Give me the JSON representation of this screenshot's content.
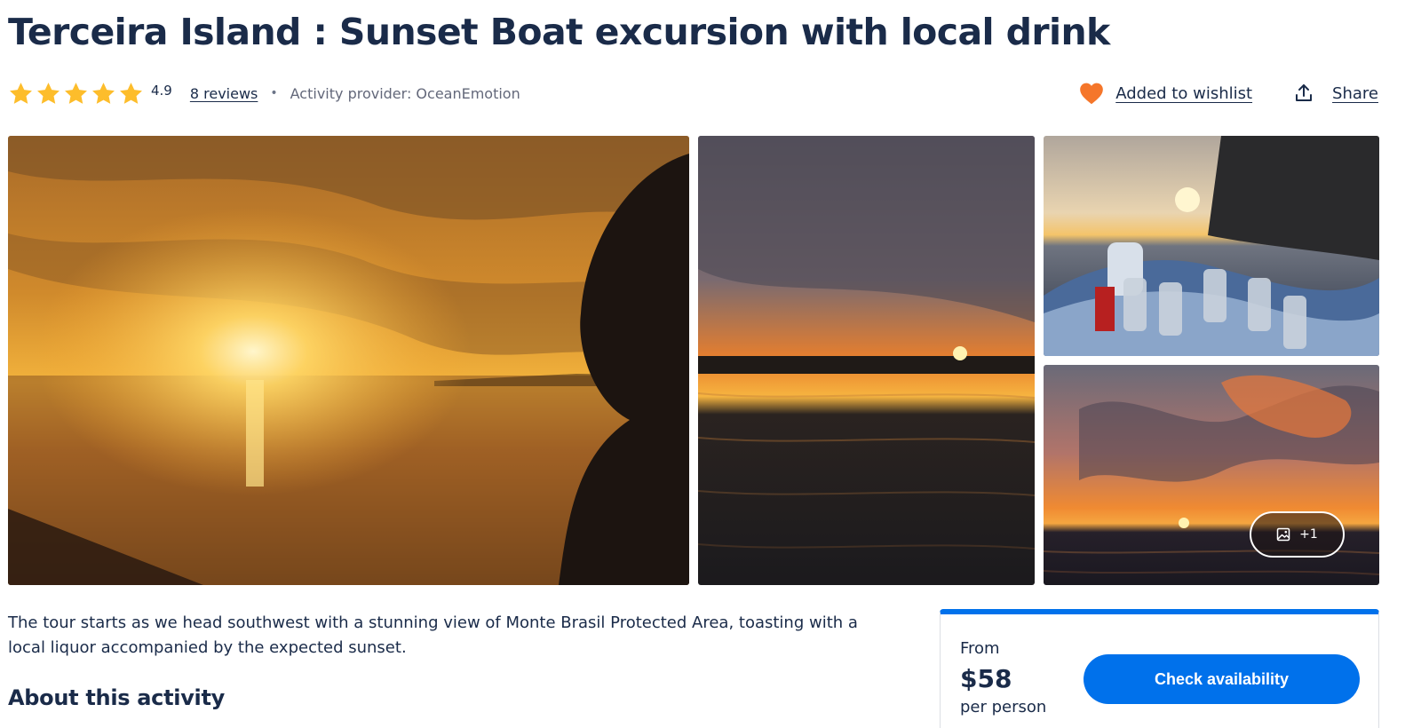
{
  "activity": {
    "title": "Terceira Island : Sunset Boat excursion with local drink",
    "rating": 4.9,
    "rating_text": "4.9",
    "stars": 5,
    "reviews_label": "8 reviews",
    "separator": "•",
    "provider_label": "Activity provider: OceanEmotion"
  },
  "actions": {
    "wishlist_label": "Added to wishlist",
    "share_label": "Share",
    "wishlist_icon": "heart-icon",
    "share_icon": "share-icon"
  },
  "gallery": {
    "more_photos_label": "+1",
    "more_photos_icon": "image-icon"
  },
  "content": {
    "description": "The tour starts as we head southwest with a stunning view of Monte Brasil Protected Area, toasting with a local liquor accompanied by the expected sunset.",
    "about_heading": "About this activity"
  },
  "booking": {
    "from_label": "From",
    "price": "$58",
    "per_person_label": "per person",
    "button_label": "Check availability"
  },
  "colors": {
    "accent": "#0071eb",
    "text": "#1a2b49",
    "star": "#fdbd2b",
    "heart": "#f5762a"
  }
}
